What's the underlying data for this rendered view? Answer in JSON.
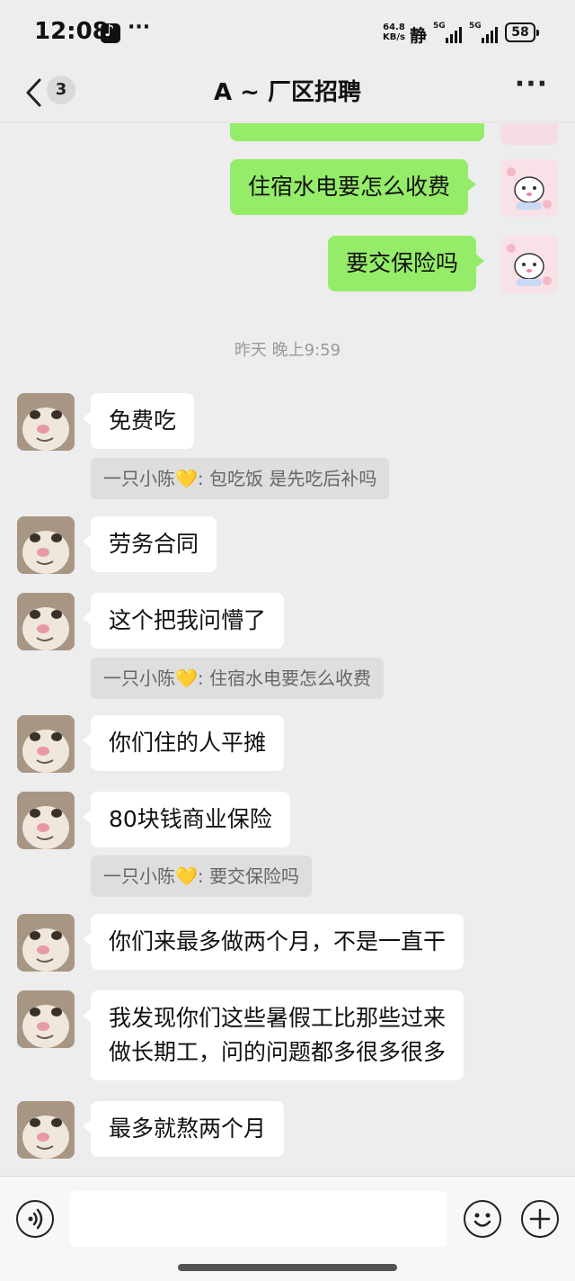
{
  "status_bar": {
    "time": "12:08",
    "dots": "···",
    "net_speed_value": "64.8",
    "net_speed_unit": "KB/s",
    "silent": "静",
    "sim1": "5G",
    "sim2": "5G",
    "battery": "58"
  },
  "header": {
    "back_count": "3",
    "title": "A ~ 厂区招聘",
    "more": "···"
  },
  "messages": {
    "me_1": "住宿水电要怎么收费",
    "me_2": "要交保险吗",
    "timestamp": "昨天 晚上9:59",
    "other_1": "免费吃",
    "quote_1": "一只小陈💛: 包吃饭 是先吃后补吗",
    "other_2": "劳务合同",
    "other_3": "这个把我问懵了",
    "quote_2": "一只小陈💛: 住宿水电要怎么收费",
    "other_4": "你们住的人平摊",
    "other_5": "80块钱商业保险",
    "quote_3": "一只小陈💛: 要交保险吗",
    "other_6": "你们来最多做两个月，不是一直干",
    "other_7_line1": "我发现你们这些暑假工比那些过来",
    "other_7_line2": "做长期工，问的问题都多很多很多",
    "other_8": "最多就熬两个月"
  },
  "input": {
    "value": ""
  },
  "icons": {
    "back": "chevron-left-icon",
    "more": "more-horizontal-icon",
    "voice": "voice-icon",
    "emoji": "emoji-icon",
    "plus": "plus-icon"
  },
  "colors": {
    "my_bubble": "#95ec69",
    "other_bubble": "#ffffff",
    "background": "#ededed"
  }
}
